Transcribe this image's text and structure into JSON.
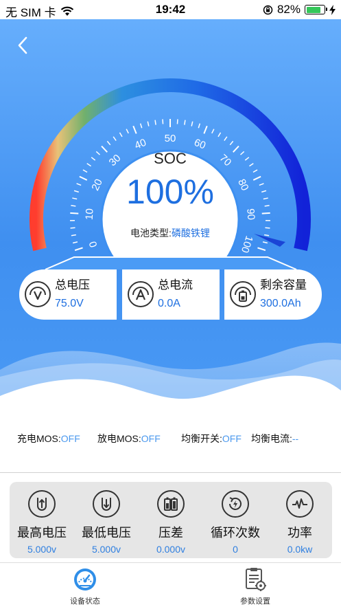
{
  "status_bar": {
    "carrier": "无 SIM 卡",
    "time": "19:42",
    "battery_percent": "82%",
    "battery_level": 0.82
  },
  "gauge": {
    "ticks": [
      "0",
      "10",
      "20",
      "30",
      "40",
      "50",
      "60",
      "70",
      "80",
      "90",
      "100"
    ],
    "soc_label": "SOC",
    "soc_value": "100%",
    "soc_level": 1.0,
    "battery_type_label": "电池类型:",
    "battery_type_value": "磷酸铁锂"
  },
  "cards": {
    "voltage": {
      "label": "总电压",
      "value": "75.0V",
      "icon": "voltage-icon"
    },
    "current": {
      "label": "总电流",
      "value": "0.0A",
      "icon": "current-icon"
    },
    "capacity": {
      "label": "剩余容量",
      "value": "300.0Ah",
      "icon": "capacity-icon"
    }
  },
  "info": {
    "charge_mos_label": "充电MOS:",
    "charge_mos_value": "OFF",
    "discharge_mos_label": "放电MOS:",
    "discharge_mos_value": "OFF",
    "balance_switch_label": "均衡开关:",
    "balance_switch_value": "OFF",
    "balance_current_label": "均衡电流:",
    "balance_current_value": "--"
  },
  "stats": [
    {
      "label": "最高电压",
      "value": "5.000v",
      "icon": "max-voltage-icon"
    },
    {
      "label": "最低电压",
      "value": "5.000v",
      "icon": "min-voltage-icon"
    },
    {
      "label": "压差",
      "value": "0.000v",
      "icon": "voltage-diff-icon"
    },
    {
      "label": "循环次数",
      "value": "0",
      "icon": "cycle-count-icon"
    },
    {
      "label": "功率",
      "value": "0.0kw",
      "icon": "power-icon"
    }
  ],
  "tabs": [
    {
      "label": "设备状态",
      "icon": "speedometer-icon",
      "active": true
    },
    {
      "label": "参数设置",
      "icon": "settings-clipboard-icon",
      "active": false
    }
  ],
  "colors": {
    "accent": "#1e6fe0",
    "value_blue": "#4a98ee",
    "hero_top": "#66aefc",
    "hero_bottom": "#3f8ff0"
  }
}
